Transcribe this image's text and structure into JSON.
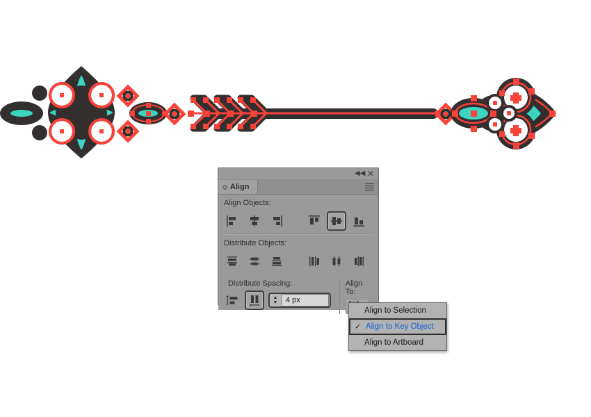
{
  "app": {
    "canvas_background": "#ffffff",
    "artwork_colors": {
      "dark": "#332f2e",
      "teal": "#3ad6c0",
      "red": "#f9423a",
      "white": "#ffffff"
    }
  },
  "panel": {
    "title_tab": "Align",
    "tab_icon": "diamond-icon",
    "collapse_icon": "double-chevron-left-icon",
    "close_icon": "close-icon",
    "menu_icon": "hamburger-menu-icon",
    "sections": {
      "align_objects": {
        "label": "Align Objects:",
        "buttons": [
          {
            "name": "horizontal-align-left",
            "pressed": false
          },
          {
            "name": "horizontal-align-center",
            "pressed": false
          },
          {
            "name": "horizontal-align-right",
            "pressed": false
          },
          {
            "name": "vertical-align-top",
            "pressed": false
          },
          {
            "name": "vertical-align-center",
            "pressed": true
          },
          {
            "name": "vertical-align-bottom",
            "pressed": false
          }
        ]
      },
      "distribute_objects": {
        "label": "Distribute Objects:",
        "buttons": [
          {
            "name": "vertical-distribute-top",
            "pressed": false
          },
          {
            "name": "vertical-distribute-center",
            "pressed": false
          },
          {
            "name": "vertical-distribute-bottom",
            "pressed": false
          },
          {
            "name": "horizontal-distribute-left",
            "pressed": false
          },
          {
            "name": "horizontal-distribute-center",
            "pressed": false
          },
          {
            "name": "horizontal-distribute-right",
            "pressed": false
          }
        ]
      },
      "distribute_spacing": {
        "label": "Distribute Spacing:",
        "buttons": [
          {
            "name": "vertical-distribute-spacing",
            "pressed": false
          },
          {
            "name": "horizontal-distribute-spacing",
            "pressed": true
          }
        ],
        "spacing_value": "4 px",
        "stepper_up_icon": "chevron-up-icon",
        "stepper_down_icon": "chevron-down-icon"
      },
      "align_to": {
        "label": "Align To:",
        "button_icon": "align-to-key-object-icon",
        "chevron_icon": "chevron-down-icon"
      }
    }
  },
  "dropdown": {
    "items": [
      {
        "label": "Align to Selection",
        "selected": false,
        "checked": false
      },
      {
        "label": "Align to Key Object",
        "selected": true,
        "checked": true
      },
      {
        "label": "Align to Artboard",
        "selected": false,
        "checked": false
      }
    ],
    "check_glyph": "✓",
    "selected_text_color": "#1565d8"
  }
}
